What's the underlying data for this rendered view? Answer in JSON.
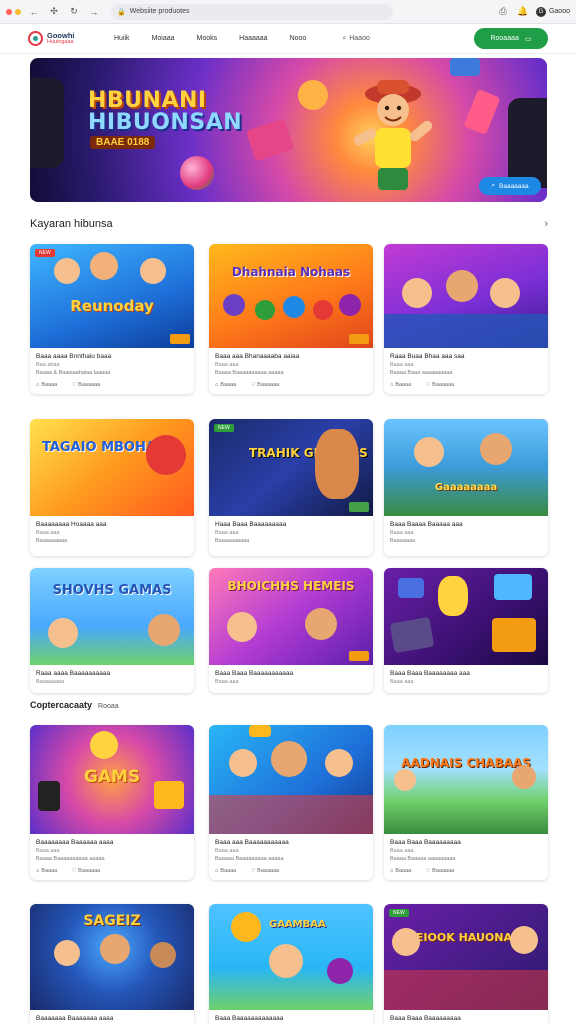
{
  "browser": {
    "url": "Websiite produotes",
    "profile_name": "Gaooo"
  },
  "header": {
    "logo_name": "Goowhi",
    "logo_tag": "Huuingaaa",
    "nav": [
      "Huiik",
      "Moiaaa",
      "Mooks",
      "Haaaaaa",
      "Nooo"
    ],
    "search_label": "Haaoo",
    "cta_label": "Rooaaaa"
  },
  "hero": {
    "title_line1": "HBUNANI",
    "title_line2": "HIBUONSAN",
    "subtitle": "BAAE 0188",
    "cta_label": "Baaaaaaa"
  },
  "section1": {
    "title": "Kayaran hibunsa"
  },
  "section2": {
    "title": "Coptercacaaty",
    "sub": "Rooaa"
  },
  "cards": [
    {
      "thumb_title": "Reunoday",
      "badge": "NEW",
      "title": "Baaa aaaa Bnnthaiu baaa",
      "sub": "Baa ahaa",
      "desc": "Baaaa & Baaiaaahaiaa laaaaa",
      "action1": "Baaaa",
      "action2": "Baaaaaa"
    },
    {
      "thumb_title": "Dhahnaia Nohaas",
      "badge": "",
      "title": "Baaa aaa Bhanaaaaba aaiaa",
      "sub": "Baaa aaa",
      "desc": "Baaaa Baaaaaaaaaa aaaaa",
      "action1": "Baaaa",
      "action2": "Baaaaaa"
    },
    {
      "thumb_title": "",
      "badge": "",
      "title": "Raaa Buaa Bhaa aaa saa",
      "sub": "Baaa aaa",
      "desc": "Baaaa Baaa aaaaaaaaaa",
      "action1": "Baaaa",
      "action2": "Baaaaaa"
    },
    {
      "thumb_title": "TAGAIO MBOHAKE",
      "badge": "",
      "title": "Baaaaaaaa Hoaaaa aaa",
      "sub": "Baaa aaa",
      "desc": "Baaaaaaaaa",
      "action1": "",
      "action2": ""
    },
    {
      "thumb_title": "TRAHIK GBAJINES",
      "badge": "NEW",
      "title": "Haaa Baaa Baaaaaaaaa",
      "sub": "Baaa aaa",
      "desc": "Baaaaaaaaaa",
      "action1": "",
      "action2": ""
    },
    {
      "thumb_title": "Gaaaaaaaa",
      "badge": "",
      "title": "Baaa Baaaa Baaaaa aaa",
      "sub": "Baaa aaa",
      "desc": "Baaaaaaa",
      "action1": "",
      "action2": ""
    },
    {
      "thumb_title": "SHOVHS GAMAS",
      "badge": "",
      "title": "Raaa aaaa Baaaaaaaaaa",
      "sub": "Baaaaaaaa",
      "desc": "",
      "action1": "",
      "action2": ""
    },
    {
      "thumb_title": "BHOICHHS HEMEIS",
      "badge": "",
      "title": "Baaa Baaa Baaaaaaaaaaa",
      "sub": "Baaa aaa",
      "desc": "",
      "action1": "",
      "action2": ""
    },
    {
      "thumb_title": "",
      "badge": "",
      "title": "Baaa Baaa Baaaaaaaa aaa",
      "sub": "Baaa aaa",
      "desc": "",
      "action1": "",
      "action2": ""
    },
    {
      "thumb_title": "GAMS",
      "badge": "",
      "title": "Baaaaaaaa Baaaaaa aaaa",
      "sub": "Baaa aaa",
      "desc": "Baaaa Baaaaaaaaaa aaaaa",
      "action1": "Baaaa",
      "action2": "Baaaaaa"
    },
    {
      "thumb_title": "",
      "badge": "",
      "title": "Baaa aaa Baaaaaaaaaaa",
      "sub": "Baaa aaa",
      "desc": "Baaaaa Baaaaaaaaa aaaaa",
      "action1": "Baaaa",
      "action2": "Baaaaaa"
    },
    {
      "thumb_title": "AADNAIS CHABAAS",
      "badge": "",
      "title": "Baaa Baaa Baaaaaaaaa",
      "sub": "Baaa aaa",
      "desc": "Baaaa Baaaaa aaaaaaaaa",
      "action1": "Baaaa",
      "action2": "Baaaaaa"
    },
    {
      "thumb_title": "SAGEIZ",
      "badge": "",
      "title": "Baaaaaaa Baaaaaaa aaaa",
      "sub": "",
      "desc": "",
      "action1": "",
      "action2": ""
    },
    {
      "thumb_title": "GAAMBAA",
      "badge": "",
      "title": "Baaa Baaaaaaaaaaaaa",
      "sub": "",
      "desc": "",
      "action1": "",
      "action2": ""
    },
    {
      "thumb_title": "SEIOOK HAUONAIS",
      "badge": "NEW",
      "title": "Baaa Baaa Baaaaaaaaa",
      "sub": "",
      "desc": "",
      "action1": "",
      "action2": ""
    }
  ],
  "colors": {
    "accent_green": "#1f9d47",
    "accent_blue": "#1e88e5",
    "badge_red": "#e53935"
  }
}
